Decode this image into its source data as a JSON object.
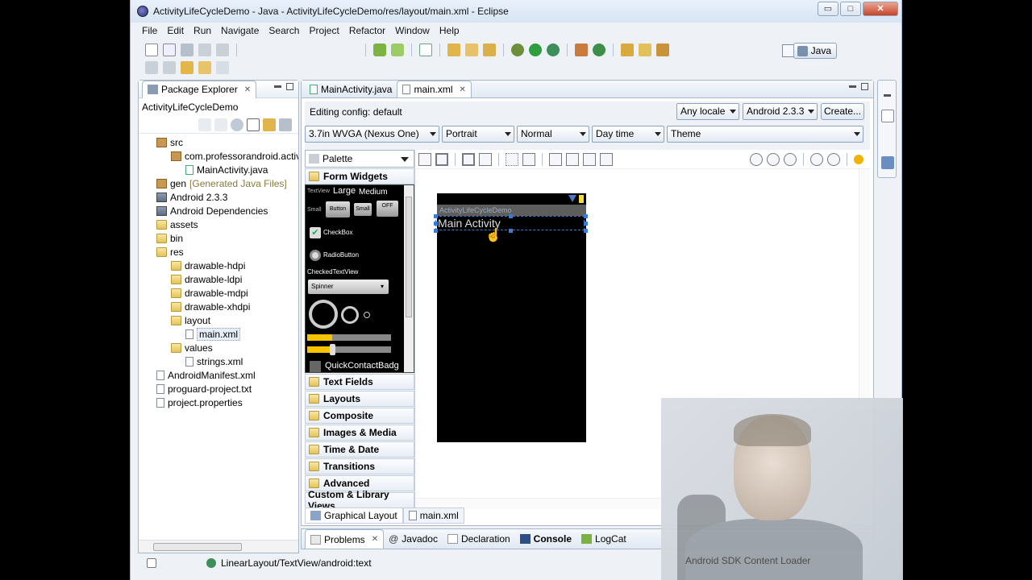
{
  "window": {
    "title": "ActivityLifeCycleDemo - Java - ActivityLifeCycleDemo/res/layout/main.xml - Eclipse",
    "controls": [
      "▭",
      "□",
      "✕"
    ]
  },
  "menu": [
    "File",
    "Edit",
    "Run",
    "Navigate",
    "Search",
    "Project",
    "Refactor",
    "Window",
    "Help"
  ],
  "perspective": {
    "label": "Java"
  },
  "package_explorer": {
    "tab_label": "Package Explorer",
    "breadcrumb": "ActivityLifeCycleDemo",
    "tree": [
      {
        "label": "src",
        "indent": 1,
        "icon": "src-folder-icon"
      },
      {
        "label": "com.professorandroid.activ",
        "indent": 2,
        "icon": "package-icon"
      },
      {
        "label": "MainActivity.java",
        "indent": 3,
        "icon": "java-file-icon"
      },
      {
        "label": "gen",
        "suffix": "[Generated Java Files]",
        "indent": 1,
        "icon": "src-folder-icon"
      },
      {
        "label": "Android 2.3.3",
        "indent": 1,
        "icon": "library-icon"
      },
      {
        "label": "Android Dependencies",
        "indent": 1,
        "icon": "library-icon"
      },
      {
        "label": "assets",
        "indent": 1,
        "icon": "folder-icon"
      },
      {
        "label": "bin",
        "indent": 1,
        "icon": "folder-icon"
      },
      {
        "label": "res",
        "indent": 1,
        "icon": "folder-icon"
      },
      {
        "label": "drawable-hdpi",
        "indent": 2,
        "icon": "folder-icon"
      },
      {
        "label": "drawable-ldpi",
        "indent": 2,
        "icon": "folder-icon"
      },
      {
        "label": "drawable-mdpi",
        "indent": 2,
        "icon": "folder-icon"
      },
      {
        "label": "drawable-xhdpi",
        "indent": 2,
        "icon": "folder-icon"
      },
      {
        "label": "layout",
        "indent": 2,
        "icon": "folder-icon"
      },
      {
        "label": "main.xml",
        "indent": 3,
        "icon": "xml-file-icon",
        "selected": true
      },
      {
        "label": "values",
        "indent": 2,
        "icon": "folder-icon"
      },
      {
        "label": "strings.xml",
        "indent": 3,
        "icon": "xml-file-icon"
      },
      {
        "label": "AndroidManifest.xml",
        "indent": 1,
        "icon": "xml-file-icon"
      },
      {
        "label": "proguard-project.txt",
        "indent": 1,
        "icon": "text-file-icon"
      },
      {
        "label": "project.properties",
        "indent": 1,
        "icon": "text-file-icon"
      }
    ]
  },
  "editor": {
    "tabs": [
      {
        "label": "MainActivity.java",
        "active": false
      },
      {
        "label": "main.xml",
        "active": true
      }
    ],
    "config_label": "Editing config:  default",
    "locale": "Any locale",
    "api": "Android 2.3.3",
    "create_button": "Create...",
    "device": "3.7in WVGA (Nexus One)",
    "orientation": "Portrait",
    "dock_mode": "Normal",
    "night_mode": "Day time",
    "theme": "Theme",
    "palette": {
      "title": "Palette",
      "open_category": "Form Widgets",
      "categories": [
        "Text Fields",
        "Layouts",
        "Composite",
        "Images & Media",
        "Time & Date",
        "Transitions",
        "Advanced"
      ],
      "custom_views": "Custom & Library Views",
      "widgets": {
        "textview_small": "TextView",
        "large": "Large",
        "medium": "Medium",
        "small": "Small",
        "button": "Button",
        "small_button": "Small",
        "toggle": "OFF",
        "checkbox": "CheckBox",
        "radio": "RadioButton",
        "checked_tv": "CheckedTextView",
        "spinner": "Spinner",
        "quick_contact": "QuickContactBadg"
      }
    },
    "phone": {
      "app_title": "ActivityLifeCycleDemo",
      "textview_text": "Main Activity"
    },
    "bottom_tabs": [
      "Graphical Layout",
      "main.xml"
    ]
  },
  "bottom_panel": {
    "tabs": [
      "Problems",
      "Javadoc",
      "Declaration",
      "Console",
      "LogCat"
    ]
  },
  "status_bar": {
    "path": "LinearLayout/TextView/android:text",
    "task": "Android SDK Content Loader"
  }
}
